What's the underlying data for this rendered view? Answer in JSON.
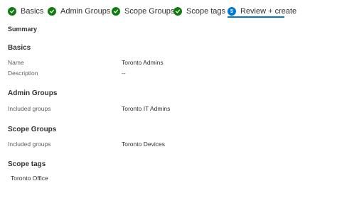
{
  "wizard": {
    "steps": [
      {
        "label": "Basics",
        "state": "complete"
      },
      {
        "label": "Admin Groups",
        "state": "complete"
      },
      {
        "label": "Scope Groups",
        "state": "complete"
      },
      {
        "label": "Scope tags",
        "state": "complete"
      },
      {
        "label": "Review + create",
        "state": "current",
        "number": "5"
      }
    ]
  },
  "summary": {
    "title": "Summary",
    "basics": {
      "heading": "Basics",
      "name_label": "Name",
      "name_value": "Toronto Admins",
      "description_label": "Description",
      "description_value": "--"
    },
    "admin_groups": {
      "heading": "Admin Groups",
      "included_label": "Included groups",
      "included_value": "Toronto IT Admins"
    },
    "scope_groups": {
      "heading": "Scope Groups",
      "included_label": "Included groups",
      "included_value": "Toronto Devices"
    },
    "scope_tags": {
      "heading": "Scope tags",
      "item": "Toronto Office"
    }
  },
  "colors": {
    "complete": "#107c10",
    "current": "#0078d4"
  }
}
